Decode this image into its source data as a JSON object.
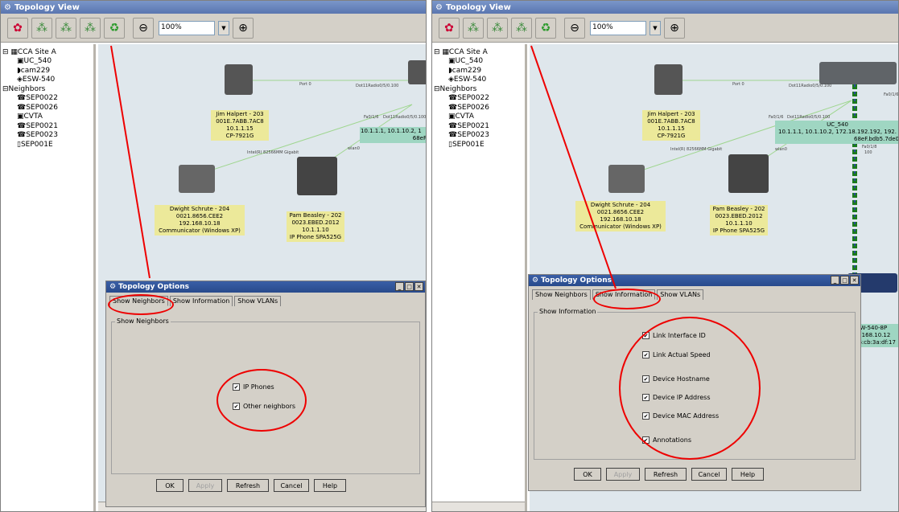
{
  "left": {
    "window_title": "Topology View",
    "zoom": "100%",
    "tree": [
      "CCA Site A",
      "UC_540",
      "cam229",
      "ESW-540",
      "Neighbors",
      "SEP0022",
      "SEP0026",
      "CVTA",
      "SEP0021",
      "SEP0023",
      "SEP001E"
    ],
    "devices": {
      "jim": [
        "Jim Halpert - 203",
        "001E.7ABB.7AC8",
        "10.1.1.15",
        "CP-7921G"
      ],
      "dwight": [
        "Dwight Schrute - 204",
        "0021.8656.CEE2",
        "192.168.10.18",
        "Communicator (Windows XP)"
      ],
      "pam": [
        "Pam Beasley - 202",
        "0023.EBED.2012",
        "10.1.1.10",
        "IP Phone SPA525G"
      ],
      "uc": "10.1.1.1, 10.1.10.2, 1",
      "uc_mac": "68eF"
    },
    "links": {
      "port0": "Port 0",
      "dot11a": "Dot11Radio0/5/0.100",
      "fa": "Fa0/1/6",
      "dot11b": "Dot11Radio0/5/0.100",
      "intel": "Intel(R) 82566MM Gigabit",
      "wlan": "wlan0"
    },
    "dialog": {
      "title": "Topology Options",
      "tabs": [
        "Show Neighbors",
        "Show Information",
        "Show VLANs"
      ],
      "group_title": "Show Neighbors",
      "options": [
        "IP Phones",
        "Other neighbors"
      ],
      "buttons": [
        "OK",
        "Apply",
        "Refresh",
        "Cancel",
        "Help"
      ]
    }
  },
  "right": {
    "window_title": "Topology View",
    "zoom": "100%",
    "tree": [
      "CCA Site A",
      "UC_540",
      "cam229",
      "ESW-540",
      "Neighbors",
      "SEP0022",
      "SEP0026",
      "CVTA",
      "SEP0021",
      "SEP0023",
      "SEP001E"
    ],
    "devices": {
      "jim": [
        "Jim Halpert - 203",
        "001E.7ABB.7AC8",
        "10.1.1.15",
        "CP-7921G"
      ],
      "dwight": [
        "Dwight Schrute - 204",
        "0021.8656.CEE2",
        "192.168.10.18",
        "Communicator (Windows XP)"
      ],
      "pam": [
        "Pam Beasley - 202",
        "0023.EBED.2012",
        "10.1.1.10",
        "IP Phone SPA525G"
      ],
      "uc": [
        "UC_540",
        "10.1.1.1, 10.1.10.2, 172.18.192.192, 192.",
        "68eF.bdb5.7de0"
      ],
      "esw": [
        "SW-540-8P",
        "2.168.10.12",
        "f6:cb:3a:df:17"
      ]
    },
    "links": {
      "port0": "Port 0",
      "dot11a": "Dot11Radio0/5/0.100",
      "fa": "Fa0/1/6",
      "dot11b": "Dot11Radio0/5/0.100",
      "intel": "Intel(R) 82566MM Gigabit",
      "wlan": "wlan0",
      "fa2": "Fa0/1/8",
      "fa3": "Fa0/1/6",
      "speed": "100"
    },
    "dialog": {
      "title": "Topology Options",
      "tabs": [
        "Show Neighbors",
        "Show Information",
        "Show VLANs"
      ],
      "group_title": "Show Information",
      "options": [
        "Link Interface ID",
        "Link Actual Speed",
        "Device Hostname",
        "Device IP Address",
        "Device MAC Address",
        "Annotations"
      ],
      "buttons": [
        "OK",
        "Apply",
        "Refresh",
        "Cancel",
        "Help"
      ]
    }
  },
  "icons": [
    "topology-icon",
    "show-neighbors-icon",
    "show-info-icon",
    "show-vlan-icon",
    "refresh-icon",
    "zoom-out-icon",
    "zoom-in-icon"
  ],
  "accent": {
    "annotation_red": "#e00000",
    "title_blue": "#3a5fa6",
    "label_yellow": "#ece99a",
    "label_green": "#9fd6c2"
  }
}
